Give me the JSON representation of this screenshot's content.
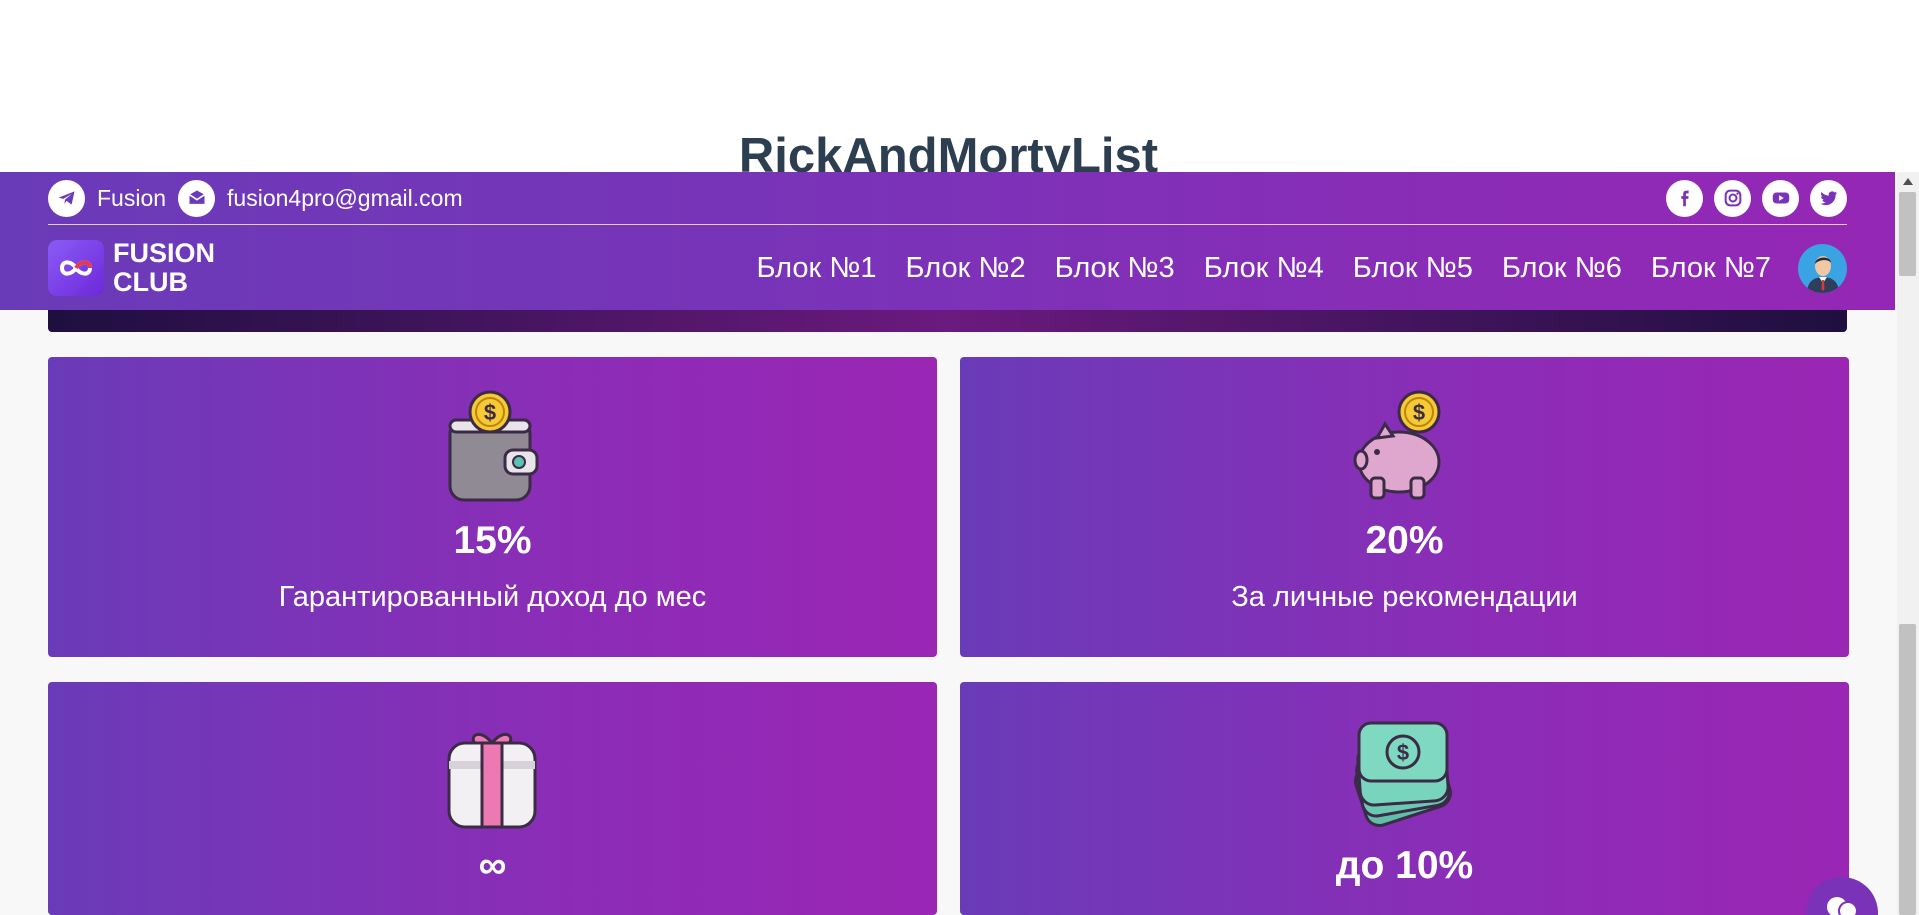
{
  "page": {
    "title": "RickAndMortyList"
  },
  "header": {
    "contacts": [
      {
        "icon": "telegram-icon",
        "text": "Fusion"
      },
      {
        "icon": "mail-icon",
        "text": "fusion4pro@gmail.com"
      }
    ],
    "socials": [
      "facebook-icon",
      "instagram-icon",
      "youtube-icon",
      "twitter-icon"
    ],
    "logo": {
      "line1": "FUSION",
      "line2": "CLUB"
    },
    "nav": [
      "Блок №1",
      "Блок №2",
      "Блок №3",
      "Блок №4",
      "Блок №5",
      "Блок №6",
      "Блок №7"
    ]
  },
  "cards": [
    {
      "icon": "wallet-coin-icon",
      "value": "15%",
      "label": "Гарантированный доход до мес"
    },
    {
      "icon": "piggy-bank-icon",
      "value": "20%",
      "label": "За личные рекомендации"
    },
    {
      "icon": "gift-icon",
      "value": "∞",
      "label": ""
    },
    {
      "icon": "money-stack-icon",
      "value": "до 10%",
      "label": ""
    }
  ],
  "colors": {
    "header_start": "#6a3bb8",
    "header_end": "#9527b5",
    "banner_dark": "#1e0f3f",
    "title_text": "#2c3e50"
  }
}
